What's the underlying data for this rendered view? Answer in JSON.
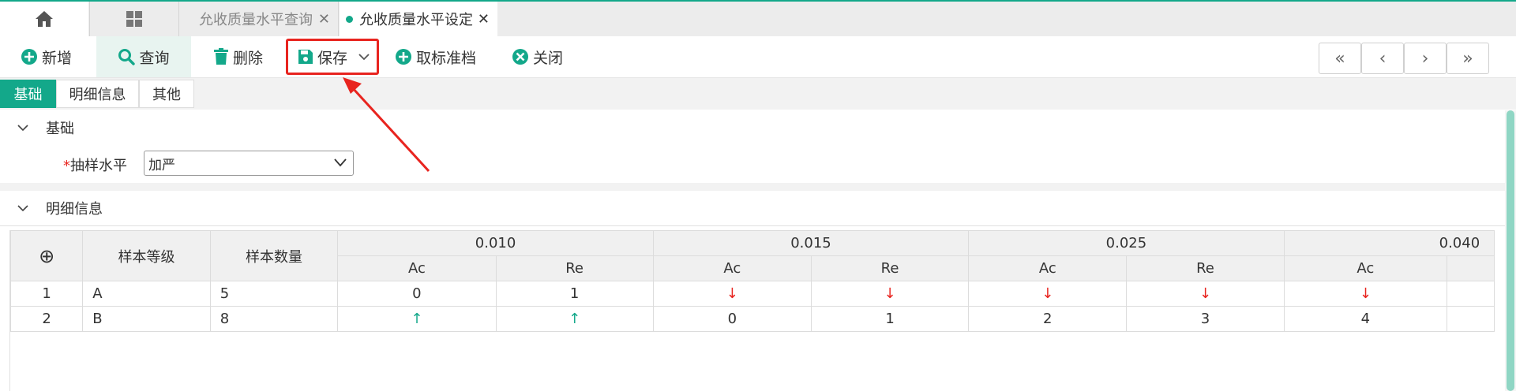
{
  "tabs": {
    "query_label": "允收质量水平查询",
    "setting_label": "允收质量水平设定",
    "close_glyph": "✕"
  },
  "toolbar": {
    "new_label": "新增",
    "query_label": "查询",
    "delete_label": "删除",
    "save_label": "保存",
    "cancel_label": "取标准档",
    "close_label": "关闭",
    "nav": [
      "«",
      "‹",
      "›",
      "»"
    ]
  },
  "section_tabs": [
    "基础",
    "明细信息",
    "其他"
  ],
  "groups": {
    "basic_title": "基础",
    "detail_title": "明细信息"
  },
  "form": {
    "required_mark": "*",
    "sampling_label": "抽样水平",
    "sampling_value": "加严"
  },
  "table": {
    "headers": {
      "add_icon": "⊕",
      "grade": "样本等级",
      "quantity": "样本数量",
      "groups": [
        "0.010",
        "0.015",
        "0.025",
        "0.040"
      ],
      "sub": [
        "Ac",
        "Re",
        "Ac",
        "Re",
        "Ac",
        "Re",
        "Ac"
      ]
    },
    "rows": [
      {
        "idx": "1",
        "grade": "A",
        "qty": "5",
        "cells": [
          "0",
          "1",
          "↓",
          "↓",
          "↓",
          "↓",
          "↓"
        ]
      },
      {
        "idx": "2",
        "grade": "B",
        "qty": "8",
        "cells": [
          "↑",
          "↑",
          "0",
          "1",
          "2",
          "3",
          "4"
        ]
      }
    ]
  },
  "colors": {
    "accent": "#13a88a",
    "highlight": "#e8241f",
    "up_arrow": "#13a88a",
    "down_arrow": "#e8241f"
  }
}
